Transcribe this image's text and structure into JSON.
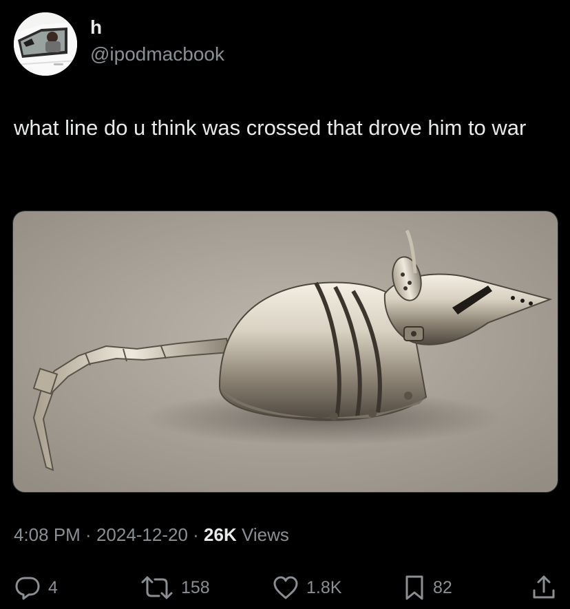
{
  "author": {
    "display_name": "h",
    "handle": "@ipodmacbook",
    "avatar_icon": "avatar-car-photo"
  },
  "tweet": {
    "text": "what line do u think was crossed that drove him to war",
    "media_description_icon": "armored-rat-sculpture-image"
  },
  "meta": {
    "time": "4:08 PM",
    "separator1": " · ",
    "date": "2024-12-20",
    "separator2": " · ",
    "views_count": "26K",
    "views_label": " Views"
  },
  "actions": {
    "replies": "4",
    "reposts": "158",
    "likes": "1.8K",
    "bookmarks": "82"
  },
  "colors": {
    "background": "#000000",
    "primary_text": "#e7e9ea",
    "secondary_text": "#8b8f94"
  }
}
